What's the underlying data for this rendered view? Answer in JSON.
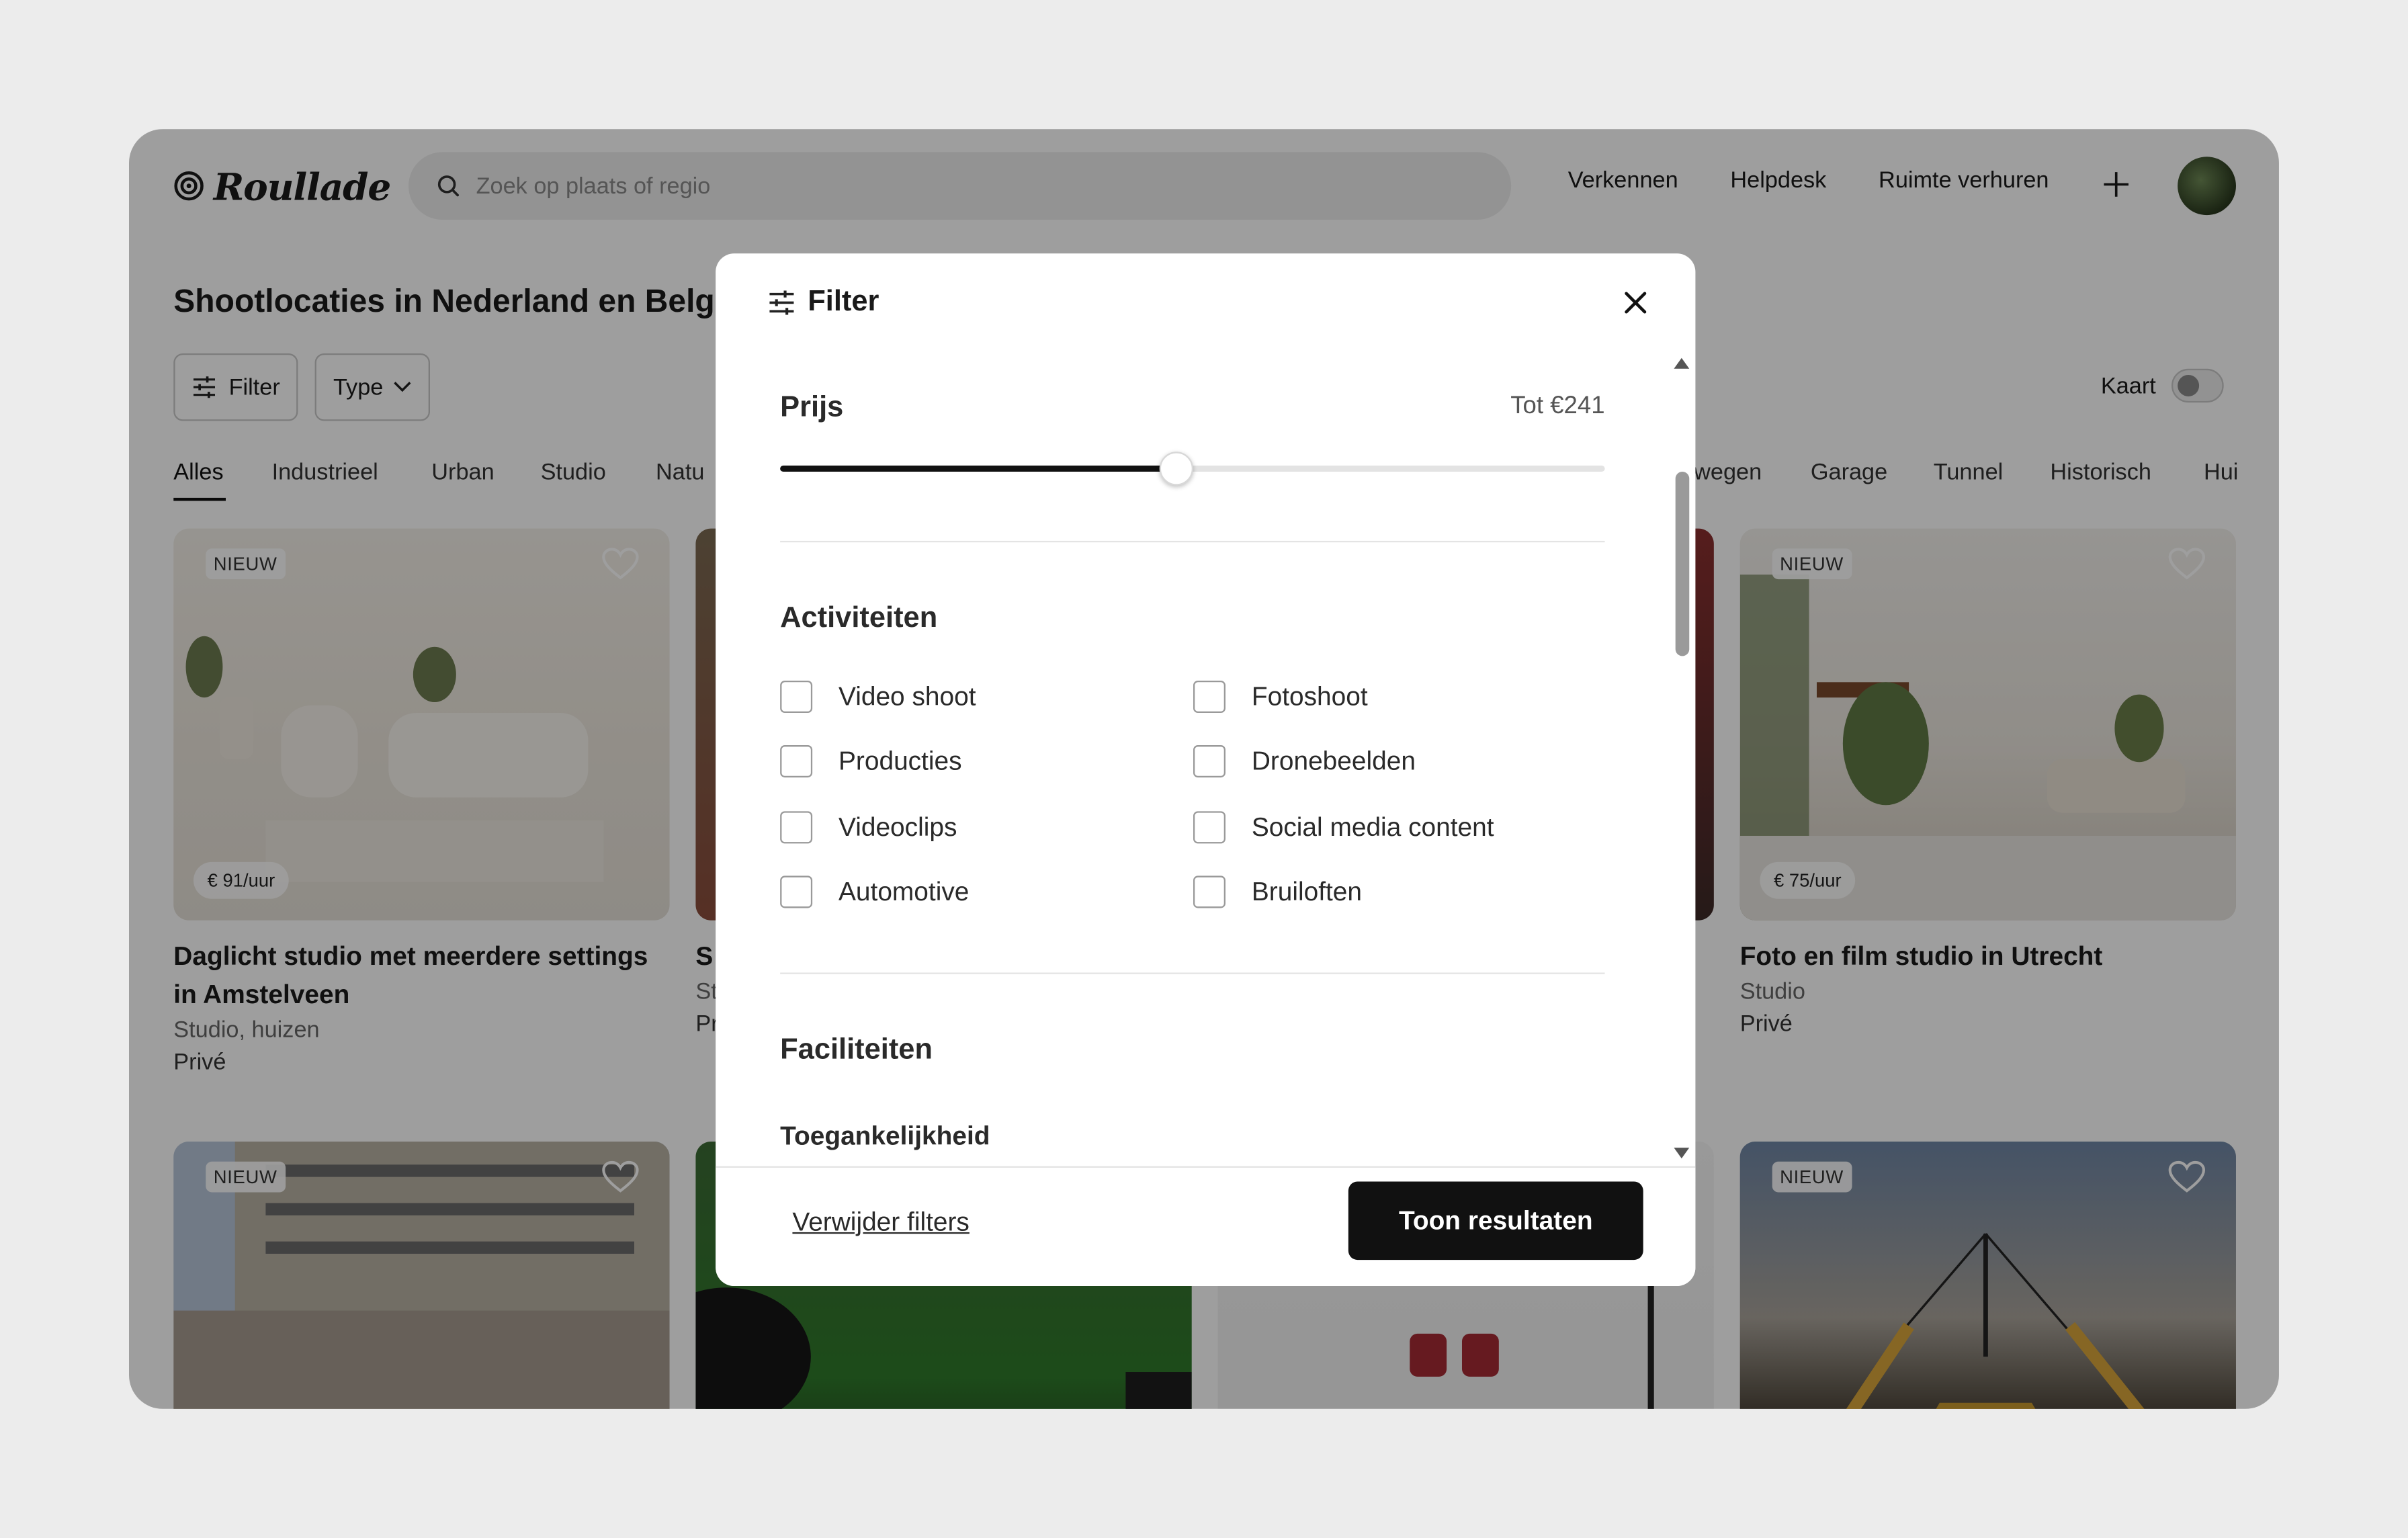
{
  "header": {
    "logo_text": "Roullade",
    "search_placeholder": "Zoek op plaats of regio",
    "nav": [
      "Verkennen",
      "Helpdesk",
      "Ruimte verhuren"
    ]
  },
  "page": {
    "title": "Shootlocaties in Nederland en Belg",
    "filter_chip": "Filter",
    "type_chip": "Type",
    "map_label": "Kaart",
    "categories_left": [
      "Alles",
      "Industrieel",
      "Urban",
      "Studio",
      "Natu"
    ],
    "categories_right": [
      "wegen",
      "Garage",
      "Tunnel",
      "Historisch",
      "Hui"
    ]
  },
  "cards": [
    {
      "badge": "NIEUW",
      "price": "€ 91/uur",
      "title": "Daglicht studio met meerdere settings in Amstelveen",
      "subtitle": "Studio, huizen",
      "privacy": "Privé"
    },
    {
      "title": "S",
      "subtitle": "St",
      "privacy": "Pr"
    },
    {
      "badge": "NIEUW",
      "price": "€ 75/uur",
      "title": "Foto en film studio in Utrecht",
      "subtitle": "Studio",
      "privacy": "Privé"
    },
    {
      "badge": "NIEUW"
    },
    {
      "badge": "NIEUW"
    }
  ],
  "modal": {
    "title": "Filter",
    "price": {
      "label": "Prijs",
      "value_text": "Tot €241",
      "fraction": 0.48
    },
    "activities": {
      "title": "Activiteiten",
      "left": [
        "Video shoot",
        "Producties",
        "Videoclips",
        "Automotive"
      ],
      "right": [
        "Fotoshoot",
        "Dronebeelden",
        "Social media content",
        "Bruiloften"
      ]
    },
    "facilities": {
      "title": "Faciliteiten",
      "subtitle": "Toegankelijkheid"
    },
    "clear_label": "Verwijder filters",
    "submit_label": "Toon resultaten"
  },
  "colors": {
    "primary": "#111111",
    "overlay": "rgba(0,0,0,0.38)"
  }
}
